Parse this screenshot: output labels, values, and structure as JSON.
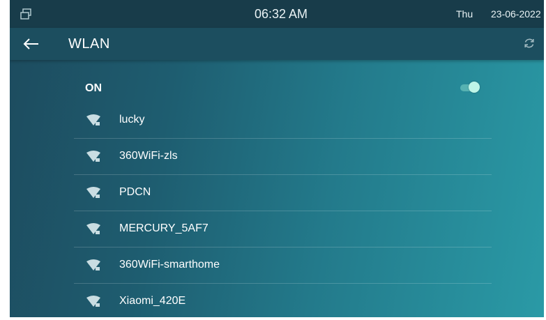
{
  "status": {
    "time": "06:32 AM",
    "day": "Thu",
    "date": "23-06-2022"
  },
  "header": {
    "title": "WLAN"
  },
  "wlan": {
    "state_label": "ON",
    "enabled": true
  },
  "networks": [
    {
      "ssid": "lucky"
    },
    {
      "ssid": "360WiFi-zls"
    },
    {
      "ssid": "PDCN"
    },
    {
      "ssid": "MERCURY_5AF7"
    },
    {
      "ssid": "360WiFi-smarthome"
    },
    {
      "ssid": "Xiaomi_420E"
    }
  ],
  "icons": {
    "status": "window-restore-icon",
    "back": "back-arrow-icon",
    "refresh": "refresh-icon",
    "network": "wifi-lock-icon"
  },
  "colors": {
    "background": "#1e6a7b",
    "statusbar": "#183c4a",
    "header": "#1c4e5f",
    "toggle_knob": "#bff5e8"
  }
}
